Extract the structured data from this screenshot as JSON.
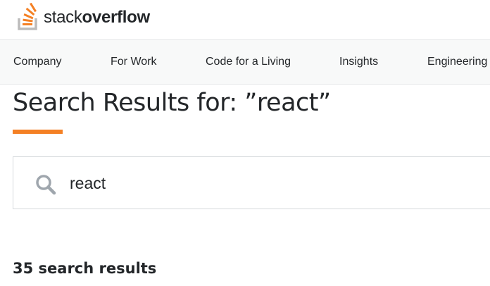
{
  "header": {
    "logo_text_light": "stack",
    "logo_text_bold": "overflow"
  },
  "nav": {
    "items": [
      {
        "label": "Company"
      },
      {
        "label": "For Work"
      },
      {
        "label": "Code for a Living"
      },
      {
        "label": "Insights"
      },
      {
        "label": "Engineering"
      }
    ]
  },
  "search": {
    "title": "Search Results for: ”react”",
    "query": "react",
    "results_count": "35 search results"
  },
  "colors": {
    "accent": "#f48024",
    "nav_background": "#f8f9f9",
    "text": "#232629",
    "logo_gray": "#bcbbbb"
  },
  "icons": {
    "logo": "stack-overflow-logo-icon",
    "search": "search-icon"
  }
}
